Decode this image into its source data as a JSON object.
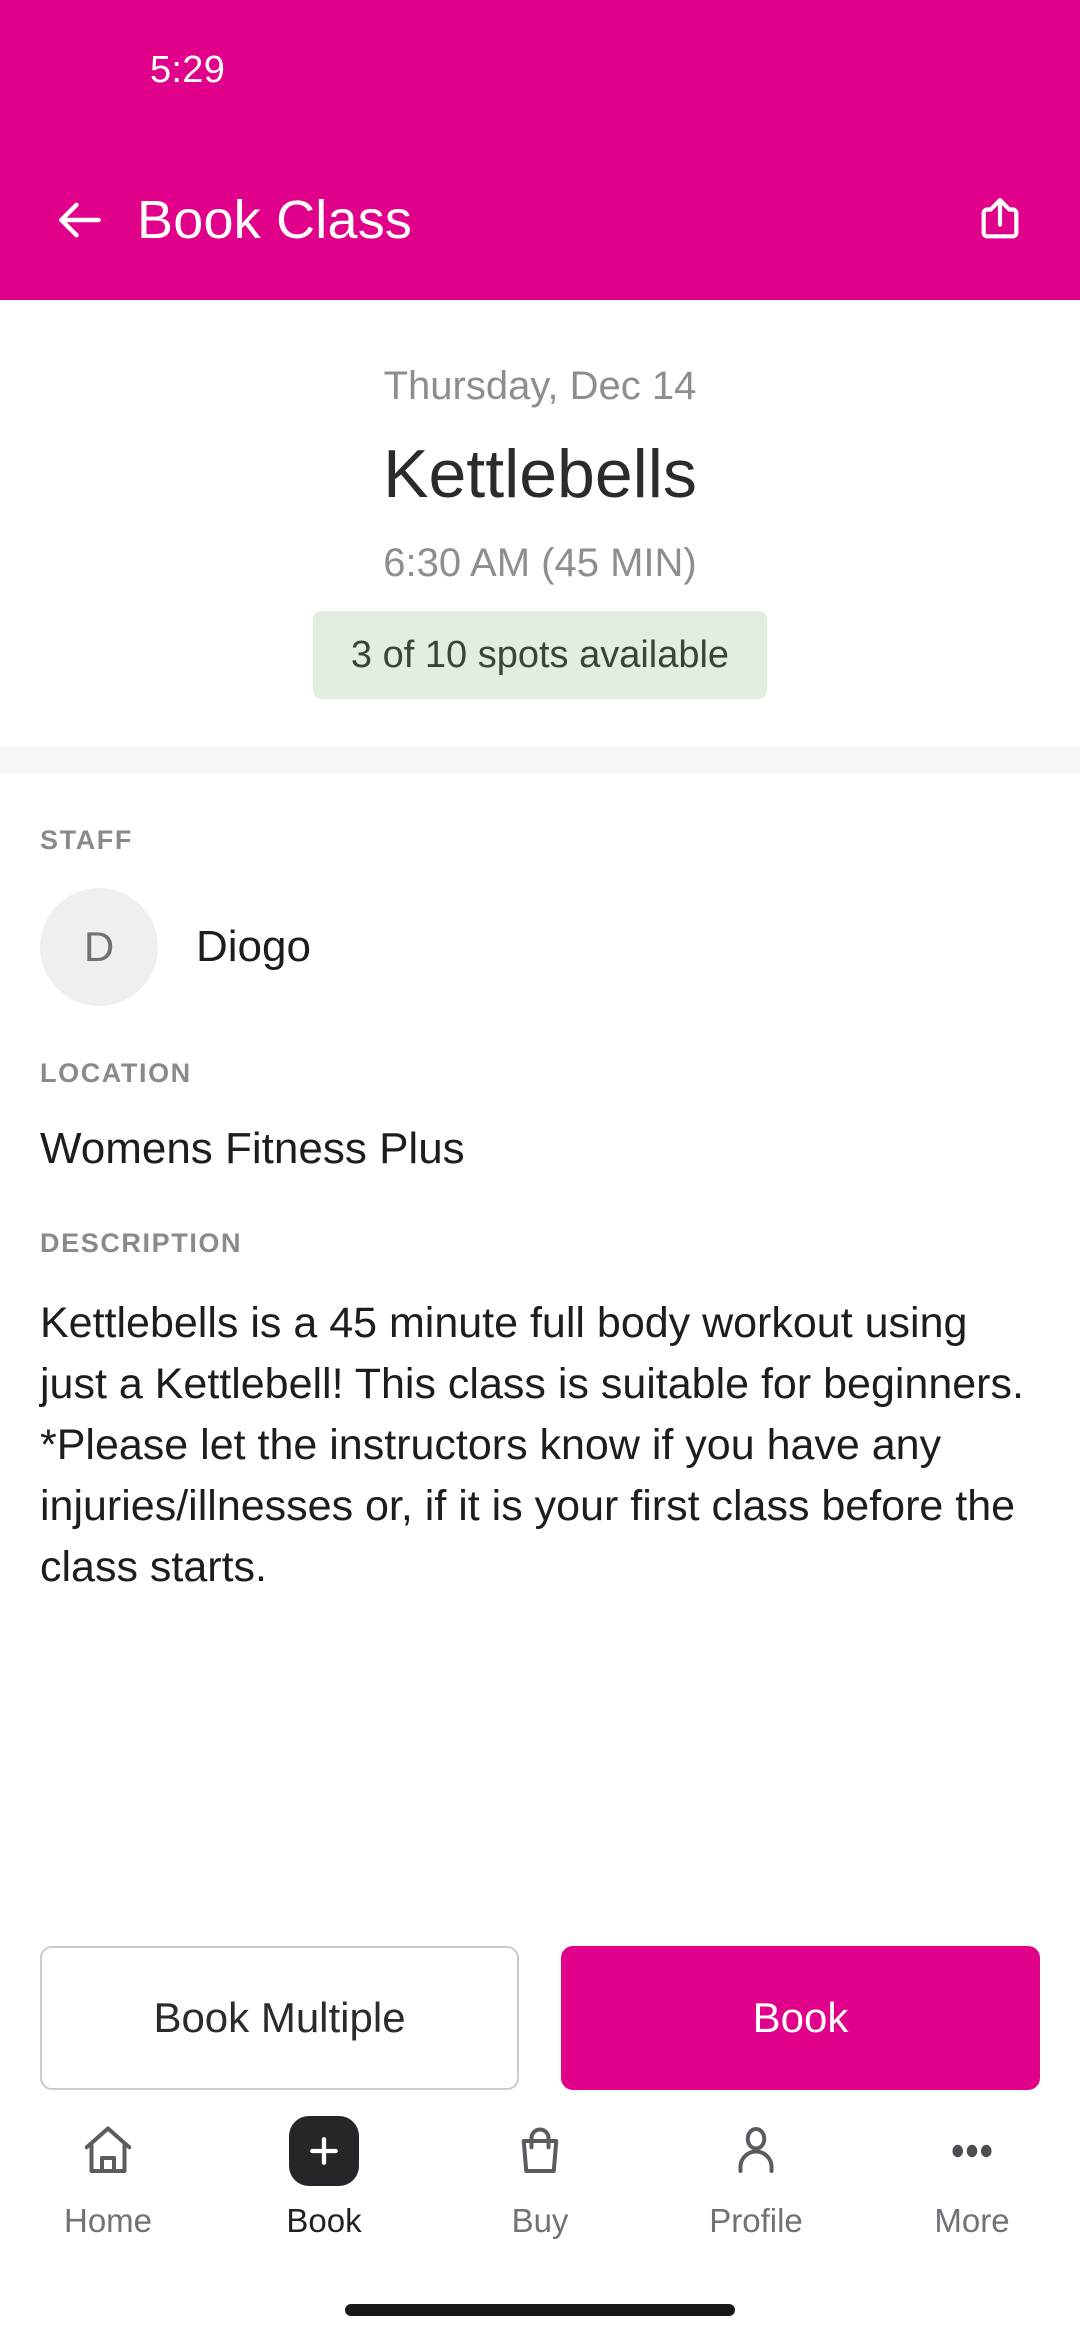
{
  "theme": {
    "accent": "#e0008a",
    "badge_bg": "#e2efe0",
    "badge_text": "#38453a",
    "muted_text": "#8e8e8e",
    "body_text": "#1d1d1d"
  },
  "status_bar": {
    "time": "5:29"
  },
  "header": {
    "title": "Book Class",
    "back_icon": "arrow-left-icon",
    "share_icon": "share-icon"
  },
  "hero": {
    "date": "Thursday, Dec 14",
    "class_name": "Kettlebells",
    "time": "6:30 AM (45 MIN)",
    "spots": "3 of 10 spots available"
  },
  "details": {
    "staff_label": "STAFF",
    "staff_initial": "D",
    "staff_name": "Diogo",
    "location_label": "LOCATION",
    "location_value": "Womens Fitness Plus",
    "description_label": "DESCRIPTION",
    "description_text": "Kettlebells is a 45 minute full body workout using just a Kettlebell! This class is suitable for beginners.   *Please let the instructors know if you have any injuries/illnesses or, if it is your first class before the class starts."
  },
  "actions": {
    "book_multiple": "Book Multiple",
    "book": "Book"
  },
  "bottom_nav": {
    "items": [
      {
        "label": "Home",
        "icon": "home-icon",
        "active": false
      },
      {
        "label": "Book",
        "icon": "plus-square-icon",
        "active": true
      },
      {
        "label": "Buy",
        "icon": "shopping-bag-icon",
        "active": false
      },
      {
        "label": "Profile",
        "icon": "person-icon",
        "active": false
      },
      {
        "label": "More",
        "icon": "ellipsis-icon",
        "active": false
      }
    ]
  }
}
